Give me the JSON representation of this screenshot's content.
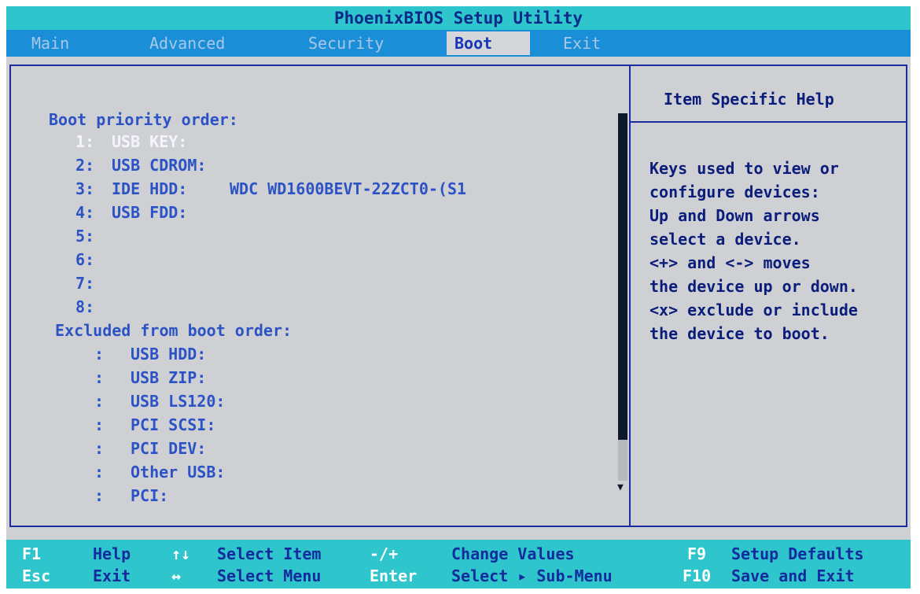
{
  "title": "PhoenixBIOS Setup Utility",
  "menu": [
    {
      "label": "Main"
    },
    {
      "label": "Advanced"
    },
    {
      "label": "Security"
    },
    {
      "label": "Boot"
    },
    {
      "label": "Exit"
    }
  ],
  "active_menu": "Boot",
  "boot": {
    "priority_heading": "Boot priority order:",
    "priority": [
      {
        "num": "1:",
        "device": "USB KEY:",
        "detail": ""
      },
      {
        "num": "2:",
        "device": "USB CDROM:",
        "detail": ""
      },
      {
        "num": "3:",
        "device": "IDE HDD:",
        "detail": "WDC WD1600BEVT-22ZCT0-(S1"
      },
      {
        "num": "4:",
        "device": "USB FDD:",
        "detail": ""
      },
      {
        "num": "5:",
        "device": "",
        "detail": ""
      },
      {
        "num": "6:",
        "device": "",
        "detail": ""
      },
      {
        "num": "7:",
        "device": "",
        "detail": ""
      },
      {
        "num": "8:",
        "device": "",
        "detail": ""
      }
    ],
    "excluded_heading": "Excluded from boot order:",
    "excluded": [
      {
        "num": ":",
        "device": "USB HDD:"
      },
      {
        "num": ":",
        "device": "USB ZIP:"
      },
      {
        "num": ":",
        "device": "USB LS120:"
      },
      {
        "num": ":",
        "device": "PCI SCSI:"
      },
      {
        "num": ":",
        "device": "PCI DEV:"
      },
      {
        "num": ":",
        "device": "Other USB:"
      },
      {
        "num": ":",
        "device": "PCI:"
      }
    ]
  },
  "help": {
    "title": "Item Specific Help",
    "lines": [
      "Keys used to view or",
      "configure devices:",
      "Up and Down arrows",
      "select a device.",
      "<+> and <-> moves",
      "the device up or down.",
      "<x> exclude or include",
      "the device to boot."
    ]
  },
  "footer": {
    "row1": [
      {
        "key": "F1",
        "desc": "Help"
      },
      {
        "key": "↑↓",
        "desc": "Select Item"
      },
      {
        "key": "-/+",
        "desc": "Change Values"
      },
      {
        "key": "F9",
        "desc": "Setup Defaults"
      }
    ],
    "row2": [
      {
        "key": "Esc",
        "desc": "Exit"
      },
      {
        "key": "↔",
        "desc": "Select Menu"
      },
      {
        "key": "Enter",
        "desc": "Select ▸ Sub-Menu"
      },
      {
        "key": "F10",
        "desc": "Save and Exit"
      }
    ]
  },
  "scroll_arrow": "▼",
  "colors": {
    "cyan": "#2ec6cc",
    "blue": "#1a8fd8",
    "panel": "#cfd0d4"
  }
}
